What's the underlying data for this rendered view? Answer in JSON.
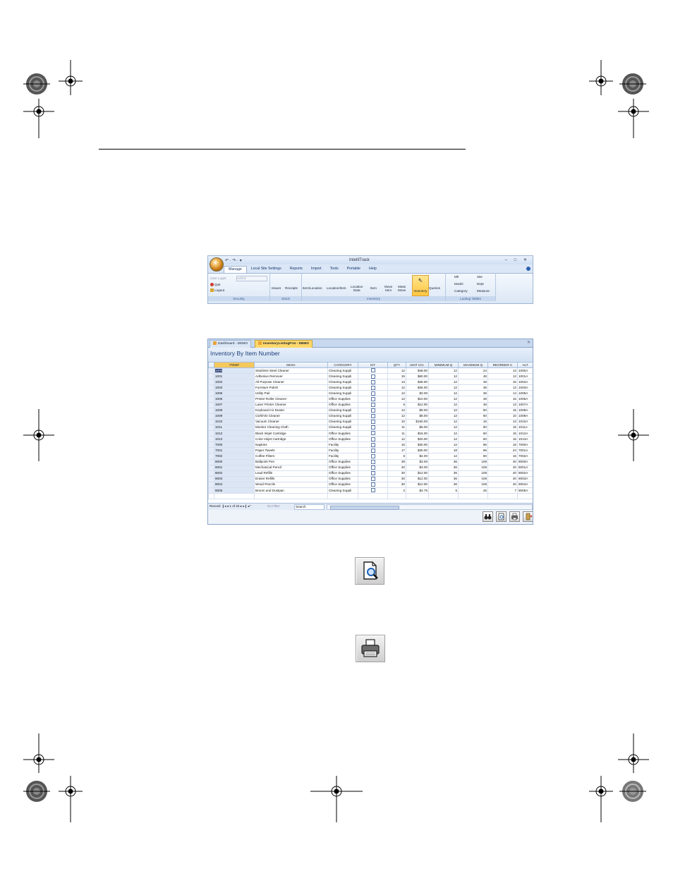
{
  "ribbon": {
    "app_title": "IntelliTrack",
    "qat": "↶ · ↷ · ▾",
    "window_controls": "– □ ✕",
    "tabs": [
      "Manage",
      "Local Site Settings",
      "Reports",
      "Import",
      "Tools",
      "Portable",
      "Help"
    ],
    "security": {
      "user_login_label": "User Login:",
      "user_login_value": "Admin",
      "quit": "Quit",
      "logout": "Logout",
      "group_label": "Security"
    },
    "stock": {
      "issues": "Issues",
      "receipts": "Receipts",
      "group_label": "Stock"
    },
    "inventory": {
      "item_location": "Item/Location",
      "location_item": "Location/Item",
      "location_data_1": "Location",
      "location_data_2": "Data",
      "item": "Item",
      "move_item_1": "Move",
      "move_item_2": "Item",
      "mass_move_1": "Mass",
      "mass_move_2": "Move",
      "inventory": "Inventory",
      "queries": "Queries",
      "group_label": "Inventory"
    },
    "lookup": {
      "mfr": "Mfr",
      "site": "Site",
      "model": "Model",
      "dept": "Dept",
      "category": "Category",
      "measure": "Measure",
      "group_label": "Lookup Tables"
    }
  },
  "datasheet": {
    "tabs": [
      "Dashboard - DEMO",
      "InventoryListingFrm - DEMO"
    ],
    "close": "✕",
    "form_title": "Inventory By Item Number",
    "columns": [
      "ITEM#",
      "DESC",
      "CATEGORY",
      "KIT",
      "QTY",
      "UNIT CO↓",
      "MINIMUM Q",
      "MAXIMUM Q",
      "REORDER C",
      "ALT"
    ],
    "rows": [
      [
        "1000",
        "Stainless Steel Cleaner",
        "Cleaning Suppli",
        "12",
        "$48.00",
        "12",
        "24",
        "13",
        "1000A"
      ],
      [
        "1001",
        "Adhesive Remover",
        "Cleaning Suppli",
        "15",
        "$60.00",
        "12",
        "48",
        "13",
        "1001A"
      ],
      [
        "1002",
        "All Purpose Cleaner",
        "Cleaning Suppli",
        "13",
        "$36.00",
        "12",
        "48",
        "15",
        "1002A"
      ],
      [
        "1003",
        "Furniture Polish",
        "Cleaning Suppli",
        "12",
        "$36.00",
        "12",
        "36",
        "13",
        "1003A"
      ],
      [
        "1005",
        "Utility Pail",
        "Cleaning Suppli",
        "12",
        "$3.00",
        "12",
        "36",
        "14",
        "1005A"
      ],
      [
        "1006",
        "Printer Roller Cleaner",
        "Office Supplies",
        "12",
        "$10.00",
        "12",
        "48",
        "15",
        "1006A"
      ],
      [
        "1007",
        "Laser Printer Cleaner",
        "Office Supplies",
        "6",
        "$12.00",
        "12",
        "48",
        "13",
        "1007A"
      ],
      [
        "1008",
        "Keyboard Air Duster",
        "Cleaning Suppli",
        "12",
        "$9.00",
        "12",
        "60",
        "15",
        "1008A"
      ],
      [
        "1009",
        "CD/DVD Cleaner",
        "Cleaning Suppli",
        "12",
        "$8.00",
        "12",
        "60",
        "10",
        "1009A"
      ],
      [
        "1010",
        "Vacuum Cleaner",
        "Cleaning Suppli",
        "10",
        "$150.00",
        "12",
        "15",
        "13",
        "1010A"
      ],
      [
        "1011",
        "Monitor Cleaning Cloth",
        "Cleaning Suppli",
        "11",
        "$6.00",
        "12",
        "60",
        "15",
        "1011A"
      ],
      [
        "1012",
        "Black Inkjet Cartridge",
        "Office Supplies",
        "11",
        "$15.00",
        "12",
        "60",
        "15",
        "1012A"
      ],
      [
        "1013",
        "Color Inkjet Cartridge",
        "Office Supplies",
        "12",
        "$20.00",
        "12",
        "60",
        "15",
        "1013A"
      ],
      [
        "7000",
        "Napkins",
        "Facility",
        "16",
        "$30.00",
        "12",
        "96",
        "18",
        "7000A"
      ],
      [
        "7001",
        "Paper Towels",
        "Facility",
        "17",
        "$30.00",
        "18",
        "96",
        "24",
        "7001A"
      ],
      [
        "7002",
        "Coffee Filters",
        "Facility",
        "5",
        "$2.00",
        "12",
        "60",
        "15",
        "7002A"
      ],
      [
        "8000",
        "Ballpoint Pen",
        "Office Supplies",
        "39",
        "$3.00",
        "36",
        "108",
        "40",
        "8000A"
      ],
      [
        "8001",
        "Mechanical Pencil",
        "Office Supplies",
        "40",
        "$3.00",
        "36",
        "108",
        "40",
        "8001A"
      ],
      [
        "8002",
        "Lead Refills",
        "Office Supplies",
        "30",
        "$12.00",
        "36",
        "108",
        "40",
        "8002A"
      ],
      [
        "8003",
        "Eraser Refills",
        "Office Supplies",
        "30",
        "$12.00",
        "36",
        "108",
        "40",
        "8003A"
      ],
      [
        "8004",
        "Wood Pencils",
        "Office Supplies",
        "30",
        "$12.00",
        "36",
        "108",
        "40",
        "8004A"
      ],
      [
        "8005",
        "Broom and Dustpan",
        "Cleaning Suppli",
        "2",
        "$4.75",
        "5",
        "25",
        "7",
        "8005A"
      ]
    ],
    "nav": {
      "record_label": "Record: ❙◂ ◂",
      "record_pos": "1 of 22",
      "record_next": "▸ ▸❙ ▸*",
      "filter": "No Filter",
      "search": "Search"
    }
  },
  "colors": {
    "ribbon_bg": "#dbe7f6",
    "active_tab": "#ffd86b",
    "highlight": "#ffc640",
    "title_blue": "#1c3f7a"
  },
  "icons": [
    "registration-mark-icon",
    "color-target-icon",
    "print-preview-icon",
    "printer-icon",
    "binoculars-icon",
    "exit-icon"
  ]
}
